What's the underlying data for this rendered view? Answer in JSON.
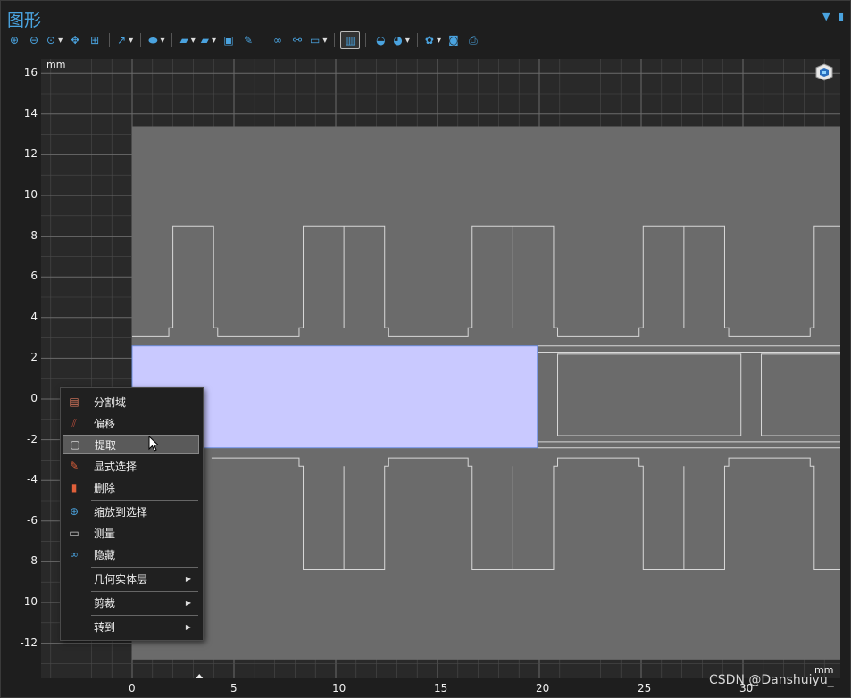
{
  "window": {
    "title": "图形"
  },
  "toolbar": {
    "buttons": [
      {
        "icon": "zoom-in-icon",
        "dd": false
      },
      {
        "icon": "zoom-out-icon",
        "dd": false
      },
      {
        "icon": "zoom-box-icon",
        "dd": true
      },
      {
        "icon": "zoom-extents-icon",
        "dd": false
      },
      {
        "icon": "zoom-selected-icon",
        "dd": false
      },
      {
        "sep": true
      },
      {
        "icon": "axis-orientation-icon",
        "dd": true
      },
      {
        "sep": true
      },
      {
        "icon": "select-object-icon",
        "dd": true
      },
      {
        "sep": true
      },
      {
        "icon": "select-domain-icon",
        "dd": true
      },
      {
        "icon": "select-boundary-icon",
        "dd": true
      },
      {
        "icon": "clear-selection-icon",
        "dd": false
      },
      {
        "icon": "paint-selection-icon",
        "dd": false
      },
      {
        "sep": true
      },
      {
        "icon": "hide-icon",
        "dd": false
      },
      {
        "icon": "connect-icon",
        "dd": false
      },
      {
        "icon": "view-settings-icon",
        "dd": true
      },
      {
        "sep": true
      },
      {
        "icon": "wireframe-toggle-icon",
        "dd": false,
        "active": true
      },
      {
        "sep": true
      },
      {
        "icon": "render-icon",
        "dd": false
      },
      {
        "icon": "lighting-icon",
        "dd": true
      },
      {
        "sep": true
      },
      {
        "icon": "scene-light-icon",
        "dd": true
      },
      {
        "icon": "camera-icon",
        "dd": false
      },
      {
        "icon": "print-icon",
        "dd": false
      }
    ]
  },
  "axes": {
    "unit": "mm",
    "y_ticks": [
      "16",
      "14",
      "12",
      "10",
      "8",
      "6",
      "4",
      "2",
      "0",
      "-2",
      "-4",
      "-6",
      "-8",
      "-10",
      "-12"
    ],
    "x_ticks": [
      "0",
      "5",
      "10",
      "15",
      "20",
      "25",
      "30"
    ]
  },
  "context_menu": {
    "items": [
      {
        "label": "分割域",
        "icon": "split-domain-icon"
      },
      {
        "label": "偏移",
        "icon": "offset-icon"
      },
      {
        "label": "提取",
        "icon": "extract-icon",
        "selected": true
      },
      {
        "label": "显式选择",
        "icon": "explicit-selection-icon"
      },
      {
        "label": "删除",
        "icon": "delete-icon"
      },
      {
        "sep": true
      },
      {
        "label": "缩放到选择",
        "icon": "zoom-to-selection-icon"
      },
      {
        "label": "测量",
        "icon": "measure-icon"
      },
      {
        "label": "隐藏",
        "icon": "hide-icon"
      },
      {
        "sep": true
      },
      {
        "label": "几何实体层",
        "icon": "",
        "submenu": true
      },
      {
        "sep": true
      },
      {
        "label": "剪裁",
        "icon": "",
        "submenu": true
      },
      {
        "sep": true
      },
      {
        "label": "转到",
        "icon": "",
        "submenu": true
      }
    ]
  },
  "watermark": "CSDN @Danshuiyu_",
  "colors": {
    "accent": "#4aa3df",
    "geometry": "#6b6b6b",
    "selection": "#c9c9ff",
    "selection_edge": "#6e8fe0",
    "grid": "#5a5a5a"
  }
}
